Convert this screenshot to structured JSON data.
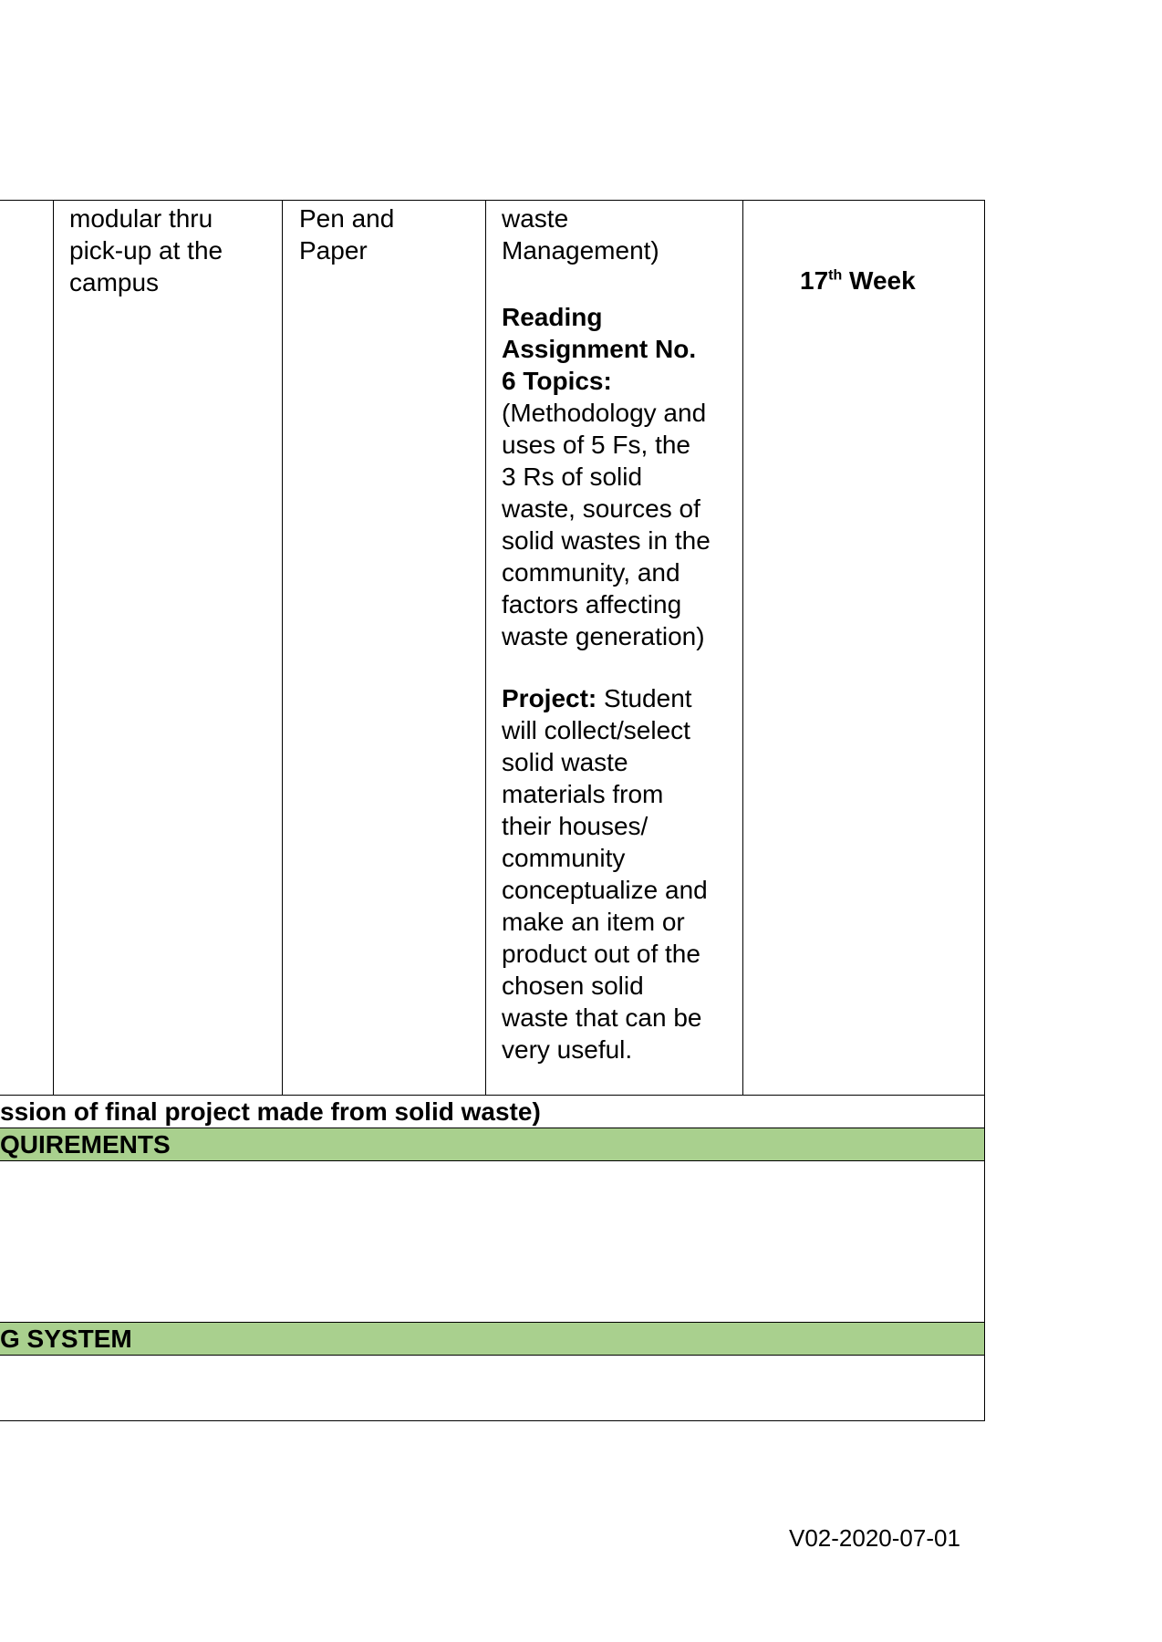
{
  "table": {
    "col_delivery": "modular thru\npick-up at the\ncampus",
    "col_assessment": "Pen and\nPaper",
    "col_content_top": "waste\nManagement)",
    "reading_heading": "Reading\nAssignment No.\n6  Topics:",
    "reading_body": "(Methodology and\nuses of 5 Fs, the\n3 Rs of solid\nwaste, sources of\nsolid wastes in the\ncommunity, and\nfactors affecting\nwaste generation)",
    "project_label": "Project:",
    "project_body_first": " Student",
    "project_body": "will collect/select\nsolid waste\nmaterials from\ntheir houses/\ncommunity\nconceptualize and\nmake an item or\nproduct out of the\nchosen solid\nwaste that can be\nvery useful.",
    "week_number": "17",
    "week_suffix": "th",
    "week_label": " Week",
    "final_row": "ssion of final project made from solid waste)",
    "requirements_band": "QUIREMENTS",
    "grading_band": "G SYSTEM"
  },
  "footer": {
    "version": "V02-2020-07-01"
  },
  "colors": {
    "band_green": "#a9d08e"
  }
}
